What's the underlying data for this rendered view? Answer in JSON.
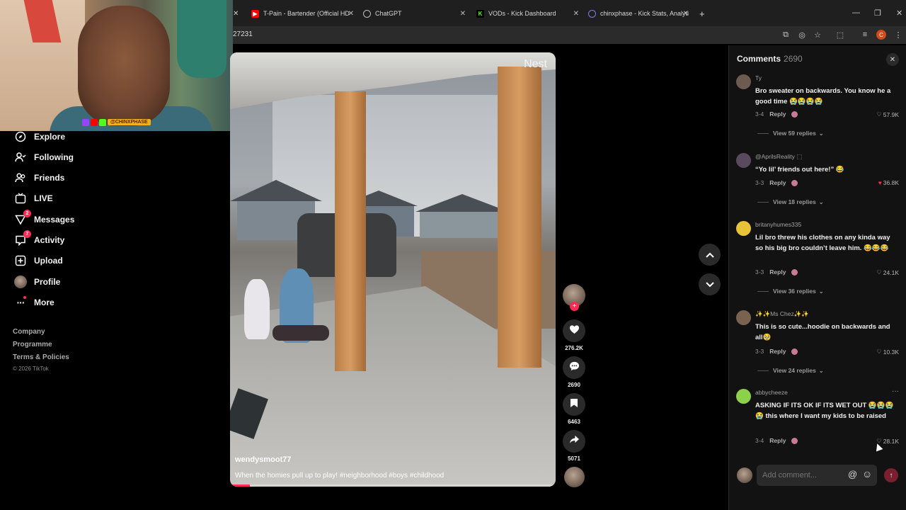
{
  "browser": {
    "tabs": [
      {
        "label": "T-Pain - Bartender (Official HD",
        "icon": "youtube-icon",
        "color": "#ff0000"
      },
      {
        "label": "ChatGPT",
        "icon": "chatgpt-icon",
        "color": "#9a9a9a"
      },
      {
        "label": "VODs - Kick Dashboard",
        "icon": "kick-icon",
        "color": "#53fc18"
      },
      {
        "label": "chinxphase - Kick Stats, Analyti",
        "icon": "stats-icon",
        "color": "#7d7de8"
      }
    ],
    "url": "27231"
  },
  "webcam": {
    "stream_tag": "@CHINXPHASE"
  },
  "sidebar": {
    "items": [
      {
        "label": "Explore",
        "icon": "compass-icon"
      },
      {
        "label": "Following",
        "icon": "following-icon"
      },
      {
        "label": "Friends",
        "icon": "friends-icon"
      },
      {
        "label": "LIVE",
        "icon": "live-icon"
      },
      {
        "label": "Messages",
        "icon": "messages-icon",
        "badge": "2"
      },
      {
        "label": "Activity",
        "icon": "activity-icon",
        "badge": "7"
      },
      {
        "label": "Upload",
        "icon": "upload-icon"
      },
      {
        "label": "Profile",
        "icon": "profile-avatar"
      },
      {
        "label": "More",
        "icon": "more-icon"
      }
    ],
    "footer": {
      "company": "Company",
      "programme": "Programme",
      "terms": "Terms & Policies",
      "copyright": "© 2026 TikTok"
    }
  },
  "video": {
    "watermark": "Nest",
    "username": "wendysmoot77",
    "caption": "When the homies pull up to play! #neighborhood  #boys #childhood",
    "progress": 0.06
  },
  "actions": {
    "likes": "276.2K",
    "comments": "2690",
    "saves": "6463",
    "shares": "5071"
  },
  "comments": {
    "title": "Comments",
    "count": "2690",
    "input_placeholder": "Add comment...",
    "items": [
      {
        "user": "Ty",
        "text": "Bro sweater on backwards. You know he a good time 😭😭😭😭",
        "date": "3-4",
        "reply": "Reply",
        "likes": "57.9K",
        "liked": false,
        "views": "View 59 replies",
        "avatar": "#6d5b52"
      },
      {
        "user": "@AprilsReality ⬚",
        "text": "“Yo lil’ friends out here!” 😂",
        "date": "3-3",
        "reply": "Reply",
        "likes": "36.8K",
        "liked": true,
        "views": "View 18 replies",
        "avatar": "#5a4a5e"
      },
      {
        "user": "britanyhumes335",
        "text": "Lil bro threw his clothes on any kinda way so his big bro couldn’t leave him. 😂😂😂",
        "date": "3-3",
        "reply": "Reply",
        "likes": "24.1K",
        "liked": false,
        "views": "View 36 replies",
        "avatar": "#e8c33a"
      },
      {
        "user": "✨✨Ms Chez✨✨",
        "text": "This is so cute...hoodie on backwards and all🥹",
        "date": "3-3",
        "reply": "Reply",
        "likes": "10.3K",
        "liked": false,
        "views": "View 24 replies",
        "avatar": "#7a6250"
      },
      {
        "user": "abbycheeze",
        "text": "ASKING IF ITS OK IF ITS WET OUT 😭😭😭😭 this where I want my kids to be raised",
        "date": "3-4",
        "reply": "Reply",
        "likes": "28.1K",
        "liked": false,
        "views": "",
        "avatar": "#8bd14a"
      }
    ]
  },
  "colors": {
    "accent": "#fe2c55",
    "panel": "#121212"
  }
}
